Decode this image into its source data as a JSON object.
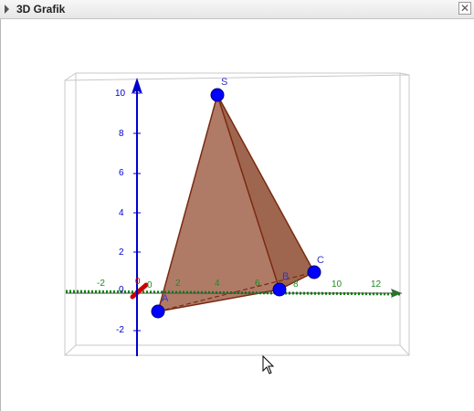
{
  "panel": {
    "title": "3D Grafik",
    "close_symbol": "✕"
  },
  "axes": {
    "z_ticks": [
      "10",
      "8",
      "6",
      "4",
      "2",
      "0",
      "-2"
    ],
    "x_ticks": [
      "-2",
      "0",
      "2",
      "4",
      "6",
      "8",
      "10",
      "12"
    ],
    "y_tick": "0",
    "x_color": "#cc0000",
    "y_color": "#008800",
    "z_color": "#0000cc"
  },
  "points": {
    "A": "A",
    "B": "B",
    "C": "C",
    "S": "S",
    "color": "#0000ff"
  },
  "pyramid": {
    "face_color": "#a0634b",
    "edge_color": "#7a2a10"
  },
  "icons": {
    "collapse": "triangle-right-icon",
    "close": "close-icon",
    "cursor": "mouse-pointer-icon"
  }
}
